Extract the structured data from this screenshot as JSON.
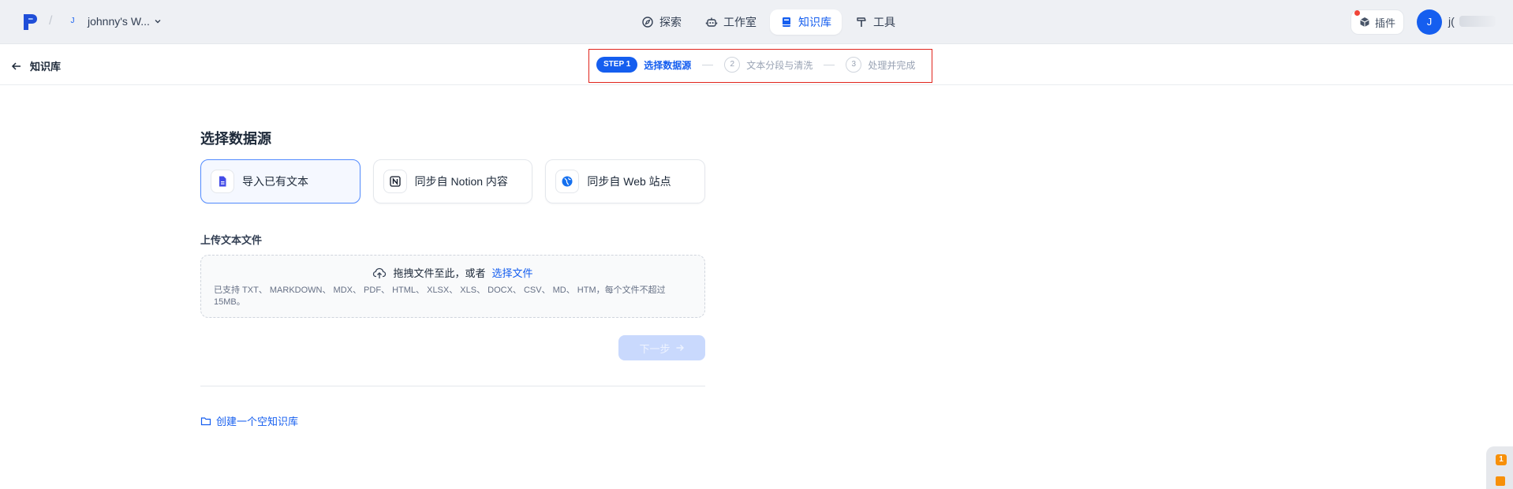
{
  "topbar": {
    "workspace_initial": "J",
    "workspace_name": "johnny's W...",
    "nav": [
      {
        "label": "探索",
        "icon": "compass-icon"
      },
      {
        "label": "工作室",
        "icon": "robot-icon"
      },
      {
        "label": "知识库",
        "icon": "book-icon",
        "active": true
      },
      {
        "label": "工具",
        "icon": "hammer-icon"
      }
    ],
    "plugin_label": "插件",
    "user_initial": "J",
    "user_name_visible": "j("
  },
  "subheader": {
    "back_label": "知识库",
    "steps": [
      {
        "badge": "STEP 1",
        "label": "选择数据源",
        "active": true
      },
      {
        "badge": "2",
        "label": "文本分段与清洗"
      },
      {
        "badge": "3",
        "label": "处理并完成"
      }
    ]
  },
  "main": {
    "title": "选择数据源",
    "sources": [
      {
        "label": "导入已有文本",
        "icon": "file-text-icon",
        "active": true
      },
      {
        "label": "同步自 Notion 内容",
        "icon": "notion-icon"
      },
      {
        "label": "同步自 Web 站点",
        "icon": "globe-icon"
      }
    ],
    "upload_label": "上传文本文件",
    "dropzone": {
      "prompt": "拖拽文件至此，或者",
      "link": "选择文件",
      "hint": "已支持 TXT、 MARKDOWN、 MDX、 PDF、 HTML、 XLSX、 XLS、 DOCX、 CSV、 MD、 HTM，每个文件不超过 15MB。"
    },
    "next_label": "下一步",
    "create_empty_label": "创建一个空知识库"
  },
  "colors": {
    "accent": "#155eef",
    "highlight_box": "#e0241c",
    "topbar_bg": "#eef0f4"
  }
}
